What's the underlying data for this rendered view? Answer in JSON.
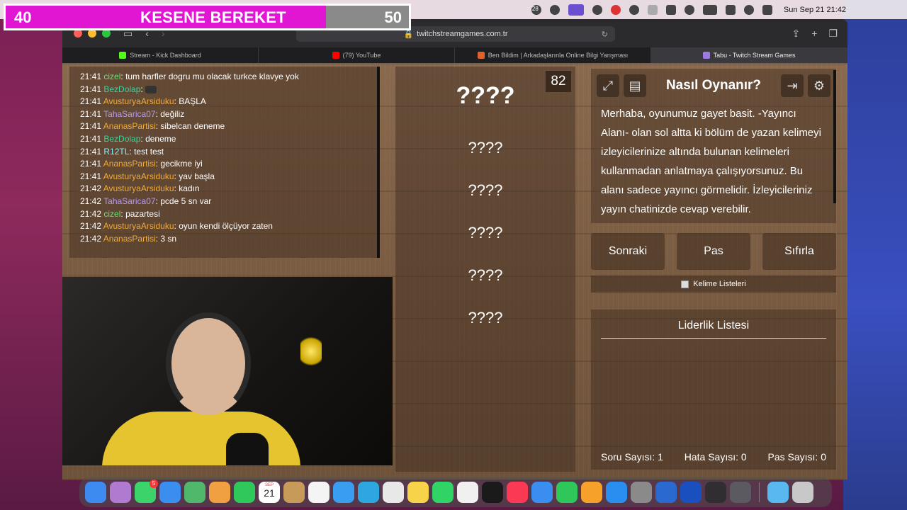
{
  "overlay": {
    "left_value": "40",
    "title": "KESENE BEREKET",
    "right_value": "50"
  },
  "menubar": {
    "badge": "28",
    "clock": "Sun Sep 21  21:42"
  },
  "browser": {
    "url": "twitchstreamgames.com.tr",
    "tabs": [
      {
        "label": "Stream - Kick Dashboard",
        "color": "#53fc18"
      },
      {
        "label": "(79) YouTube",
        "color": "#ff0000"
      },
      {
        "label": "Ben Bildim | Arkadaşlarınla Online Bilgi Yarışması",
        "color": "#e0622a"
      },
      {
        "label": "Tabu - Twitch Stream Games",
        "color": "#9b7be0"
      }
    ]
  },
  "chat": [
    {
      "time": "21:41",
      "user": "cizel",
      "color": "#6ee07a",
      "msg": "tum harfler dogru mu olacak turkce klavye yok"
    },
    {
      "time": "21:41",
      "user": "BezDolap",
      "color": "#3ad39c",
      "msg": ""
    },
    {
      "time": "21:41",
      "user": "AvusturyaArsiduku",
      "color": "#f0a93a",
      "msg": "BAŞLA"
    },
    {
      "time": "21:41",
      "user": "TahaSarica07",
      "color": "#b99be8",
      "msg": "değiliz"
    },
    {
      "time": "21:41",
      "user": "AnanasPartisi",
      "color": "#f0a93a",
      "msg": "sibelcan deneme"
    },
    {
      "time": "21:41",
      "user": "BezDolap",
      "color": "#3ad39c",
      "msg": "deneme"
    },
    {
      "time": "21:41",
      "user": "R12TL",
      "color": "#7ff0ff",
      "msg": "test test"
    },
    {
      "time": "21:41",
      "user": "AnanasPartisi",
      "color": "#f0a93a",
      "msg": "gecikme iyi"
    },
    {
      "time": "21:41",
      "user": "AvusturyaArsiduku",
      "color": "#f0a93a",
      "msg": "yav başla"
    },
    {
      "time": "21:42",
      "user": "AvusturyaArsiduku",
      "color": "#f0a93a",
      "msg": "kadın"
    },
    {
      "time": "21:42",
      "user": "TahaSarica07",
      "color": "#b99be8",
      "msg": "pcde 5 sn var"
    },
    {
      "time": "21:42",
      "user": "cizel",
      "color": "#6ee07a",
      "msg": "pazartesi"
    },
    {
      "time": "21:42",
      "user": "AvusturyaArsiduku",
      "color": "#f0a93a",
      "msg": "oyun kendi ölçüyor zaten"
    },
    {
      "time": "21:42",
      "user": "AnanasPartisi",
      "color": "#f0a93a",
      "msg": "3 sn"
    }
  ],
  "game": {
    "counter": "82",
    "main_word": "????",
    "forbidden": [
      "????",
      "????",
      "????",
      "????",
      "????"
    ]
  },
  "info": {
    "title": "Nasıl Oynanır?",
    "body": "Merhaba, oyunumuz gayet basit. -Yayıncı Alanı- olan sol altta ki bölüm de yazan kelimeyi izleyicilerinize altında bulunan kelimeleri kullanmadan anlatmaya çalışıyorsunuz. Bu alanı sadece yayıncı görmelidir. İzleyicileriniz yayın chatinizde cevap verebilir."
  },
  "actions": {
    "next": "Sonraki",
    "pass": "Pas",
    "reset": "Sıfırla"
  },
  "word_lists": "Kelime Listeleri",
  "leaderboard": {
    "title": "Liderlik Listesi"
  },
  "stats": {
    "questions": "Soru Sayısı: 1",
    "errors": "Hata Sayısı: 0",
    "passes": "Pas Sayısı: 0"
  },
  "dock": {
    "calendar_month": "SEP",
    "calendar_day": "21",
    "messages_badge": "5",
    "apps": [
      {
        "name": "finder-app",
        "color": "#3d8bf0"
      },
      {
        "name": "launchpad-app",
        "color": "#b07ad0"
      },
      {
        "name": "messages-app",
        "color": "#3bd46a"
      },
      {
        "name": "mail-app",
        "color": "#3a8ef0"
      },
      {
        "name": "maps-app",
        "color": "#4fb86a"
      },
      {
        "name": "photos-app",
        "color": "#f0a040"
      },
      {
        "name": "facetime-app",
        "color": "#2ec95a"
      },
      {
        "name": "calendar-app",
        "color": "#ffffff"
      },
      {
        "name": "notes-folder-app",
        "color": "#c79a5a"
      },
      {
        "name": "reminders-app",
        "color": "#f4f4f4"
      },
      {
        "name": "safari-app",
        "color": "#3a9ef0"
      },
      {
        "name": "telegram-app",
        "color": "#2ea6e0"
      },
      {
        "name": "chrome-app",
        "color": "#e8e8e8"
      },
      {
        "name": "notes-app",
        "color": "#f7d34a"
      },
      {
        "name": "whatsapp-app",
        "color": "#2fd366"
      },
      {
        "name": "freeform-app",
        "color": "#f0f0f0"
      },
      {
        "name": "appletv-app",
        "color": "#1a1a1a"
      },
      {
        "name": "music-app",
        "color": "#fa3a55"
      },
      {
        "name": "keynote-app",
        "color": "#3a8ef0"
      },
      {
        "name": "numbers-app",
        "color": "#2fc75a"
      },
      {
        "name": "pages-app",
        "color": "#f6a12a"
      },
      {
        "name": "appstore-app",
        "color": "#2a8ef0"
      },
      {
        "name": "settings-app",
        "color": "#8a8a8a"
      },
      {
        "name": "xcode-app",
        "color": "#2a6ad0"
      },
      {
        "name": "wd-app",
        "color": "#1a4fc0"
      },
      {
        "name": "obs-app",
        "color": "#302e31"
      },
      {
        "name": "quicktime-app",
        "color": "#5a5a60"
      },
      {
        "name": "downloads-folder",
        "color": "#5ab8f0"
      },
      {
        "name": "trash-app",
        "color": "#c8c8c8"
      }
    ]
  }
}
